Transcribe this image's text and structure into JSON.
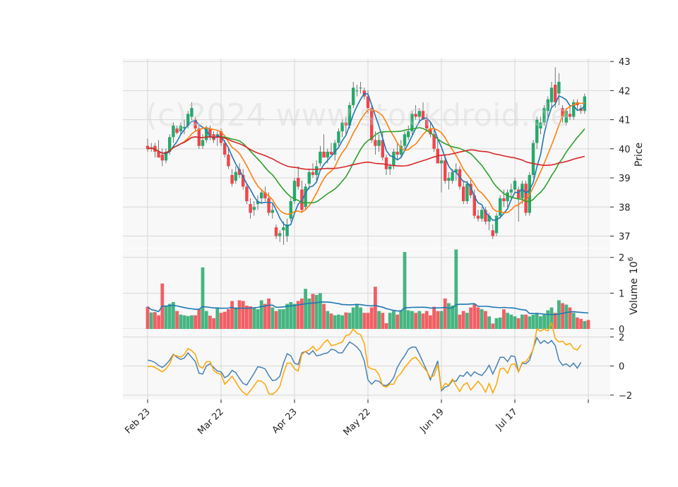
{
  "watermark": "(c)2024 www.stockdroid.de",
  "colors": {
    "up": "#26a96c",
    "down": "#f0454a",
    "sma5": "#1f77b4",
    "sma10": "#ff7f0e",
    "sma20": "#2ca02c",
    "sma50": "#d62728",
    "volma": "#1f77b4",
    "osc1": "#4682b4",
    "osc2": "#ffa500",
    "panel_bg": "#f8f8f8",
    "grid": "#d6d6d6"
  },
  "chart_data": [
    {
      "type": "candlestick",
      "ylabel": "Price",
      "ylim": [
        36.6,
        43.1
      ],
      "yticks": [
        "37",
        "38",
        "39",
        "40",
        "41",
        "42",
        "43"
      ],
      "x_ticks": [
        {
          "label": "Feb 23",
          "index": 0
        },
        {
          "label": "Mar 22",
          "index": 20
        },
        {
          "label": "Apr 23",
          "index": 40
        },
        {
          "label": "May 22",
          "index": 60
        },
        {
          "label": "Jun 19",
          "index": 80
        },
        {
          "label": "Jul 17",
          "index": 100
        },
        {
          "label": "",
          "index": 120
        }
      ],
      "grid": true,
      "ohlc": [
        [
          40.1,
          40.35,
          39.9,
          40.0
        ],
        [
          40.0,
          40.2,
          39.9,
          40.05
        ],
        [
          40.1,
          40.2,
          39.7,
          39.9
        ],
        [
          39.9,
          40.3,
          39.7,
          39.7
        ],
        [
          39.8,
          40.0,
          39.4,
          39.6
        ],
        [
          39.6,
          40.0,
          39.5,
          39.9
        ],
        [
          39.9,
          40.5,
          39.8,
          40.4
        ],
        [
          40.4,
          40.9,
          40.2,
          40.8
        ],
        [
          40.7,
          40.8,
          40.5,
          40.55
        ],
        [
          40.6,
          40.9,
          40.5,
          40.8
        ],
        [
          40.7,
          41.0,
          40.5,
          40.75
        ],
        [
          40.8,
          41.3,
          40.7,
          41.2
        ],
        [
          41.1,
          41.6,
          41.0,
          41.4
        ],
        [
          41.0,
          41.1,
          40.6,
          40.7
        ],
        [
          40.7,
          40.8,
          40.0,
          40.1
        ],
        [
          40.1,
          40.5,
          40.0,
          40.3
        ],
        [
          40.3,
          40.8,
          40.2,
          40.7
        ],
        [
          40.7,
          40.8,
          40.3,
          40.4
        ],
        [
          40.5,
          40.6,
          40.2,
          40.3
        ],
        [
          40.4,
          40.6,
          40.1,
          40.5
        ],
        [
          40.6,
          40.7,
          40.1,
          40.2
        ],
        [
          40.2,
          40.3,
          39.7,
          39.8
        ],
        [
          39.8,
          40.0,
          39.3,
          39.4
        ],
        [
          39.1,
          39.3,
          38.7,
          38.8
        ],
        [
          38.9,
          39.4,
          38.8,
          39.2
        ],
        [
          39.3,
          39.5,
          39.0,
          39.1
        ],
        [
          39.1,
          39.3,
          38.6,
          38.7
        ],
        [
          38.7,
          38.8,
          38.1,
          38.2
        ],
        [
          38.1,
          38.3,
          37.6,
          37.8
        ],
        [
          37.9,
          38.2,
          37.7,
          38.0
        ],
        [
          38.1,
          38.4,
          37.9,
          38.2
        ],
        [
          38.3,
          38.6,
          38.1,
          38.5
        ],
        [
          38.5,
          38.7,
          38.2,
          38.3
        ],
        [
          38.3,
          38.5,
          37.7,
          37.8
        ],
        [
          37.8,
          38.1,
          37.6,
          37.9
        ],
        [
          37.3,
          37.4,
          36.9,
          37.0
        ],
        [
          37.0,
          37.2,
          36.8,
          37.1
        ],
        [
          37.2,
          37.5,
          36.7,
          37.3
        ],
        [
          37.0,
          37.6,
          36.8,
          37.4
        ],
        [
          37.6,
          38.3,
          37.5,
          38.2
        ],
        [
          38.2,
          39.0,
          38.1,
          38.9
        ],
        [
          39.0,
          39.4,
          38.6,
          38.7
        ],
        [
          38.6,
          38.9,
          37.8,
          37.9
        ],
        [
          38.0,
          38.8,
          37.9,
          38.7
        ],
        [
          38.8,
          39.3,
          38.6,
          39.2
        ],
        [
          39.2,
          39.5,
          39.0,
          39.1
        ],
        [
          39.1,
          39.6,
          38.9,
          39.4
        ],
        [
          39.5,
          40.1,
          39.4,
          39.9
        ],
        [
          39.9,
          40.5,
          39.7,
          39.7
        ],
        [
          39.7,
          40.0,
          39.5,
          39.9
        ],
        [
          39.9,
          40.2,
          39.8,
          39.8
        ],
        [
          39.8,
          40.3,
          39.6,
          40.2
        ],
        [
          40.2,
          40.7,
          40.1,
          40.6
        ],
        [
          40.6,
          41.0,
          40.4,
          40.9
        ],
        [
          40.9,
          41.1,
          40.5,
          40.8
        ],
        [
          40.8,
          41.6,
          40.7,
          41.5
        ],
        [
          41.5,
          42.3,
          41.4,
          42.1
        ],
        [
          42.0,
          42.2,
          41.8,
          42.0
        ],
        [
          42.1,
          42.3,
          41.9,
          42.1
        ],
        [
          42.0,
          42.1,
          41.7,
          41.8
        ],
        [
          41.8,
          42.0,
          41.2,
          41.4
        ],
        [
          41.4,
          41.5,
          40.2,
          40.3
        ],
        [
          40.3,
          40.6,
          39.8,
          40.1
        ],
        [
          40.1,
          40.5,
          39.9,
          40.3
        ],
        [
          40.3,
          40.6,
          39.6,
          39.7
        ],
        [
          39.7,
          39.8,
          39.1,
          39.3
        ],
        [
          39.3,
          39.5,
          39.1,
          39.4
        ],
        [
          39.4,
          40.0,
          39.3,
          39.9
        ],
        [
          39.9,
          40.2,
          39.6,
          39.8
        ],
        [
          39.8,
          40.3,
          39.7,
          40.1
        ],
        [
          40.1,
          40.6,
          40.0,
          40.5
        ],
        [
          40.4,
          40.8,
          40.3,
          40.6
        ],
        [
          40.6,
          41.3,
          40.5,
          41.2
        ],
        [
          41.2,
          41.5,
          41.0,
          41.1
        ],
        [
          41.1,
          41.4,
          40.9,
          41.3
        ],
        [
          41.3,
          41.6,
          41.1,
          41.0
        ],
        [
          41.0,
          41.2,
          40.6,
          40.7
        ],
        [
          40.7,
          40.9,
          40.4,
          40.5
        ],
        [
          40.5,
          40.7,
          39.9,
          40.0
        ],
        [
          40.0,
          40.4,
          39.6,
          39.5
        ],
        [
          39.5,
          39.8,
          38.5,
          39.6
        ],
        [
          39.6,
          39.8,
          38.8,
          38.9
        ],
        [
          38.9,
          39.2,
          38.6,
          39.0
        ],
        [
          38.9,
          39.3,
          38.8,
          39.2
        ],
        [
          39.2,
          39.5,
          38.9,
          39.3
        ],
        [
          39.3,
          39.4,
          38.6,
          38.7
        ],
        [
          38.7,
          38.9,
          38.1,
          38.2
        ],
        [
          38.2,
          38.9,
          38.1,
          38.8
        ],
        [
          38.8,
          39.0,
          38.3,
          38.4
        ],
        [
          38.4,
          38.6,
          37.6,
          37.7
        ],
        [
          37.7,
          37.9,
          37.5,
          37.6
        ],
        [
          37.6,
          38.0,
          37.5,
          37.9
        ],
        [
          37.9,
          38.0,
          37.4,
          37.5
        ],
        [
          37.5,
          37.8,
          37.2,
          37.7
        ],
        [
          37.2,
          37.4,
          36.9,
          37.0
        ],
        [
          37.1,
          37.8,
          37.0,
          37.7
        ],
        [
          37.7,
          38.4,
          37.6,
          38.3
        ],
        [
          38.3,
          38.6,
          38.0,
          38.2
        ],
        [
          38.2,
          38.6,
          38.0,
          38.5
        ],
        [
          38.5,
          38.8,
          38.2,
          38.6
        ],
        [
          38.6,
          39.0,
          38.5,
          38.9
        ],
        [
          38.6,
          38.7,
          37.5,
          38.3
        ],
        [
          38.3,
          38.9,
          38.1,
          38.8
        ],
        [
          38.8,
          38.9,
          37.7,
          37.8
        ],
        [
          37.8,
          39.2,
          37.7,
          39.1
        ],
        [
          39.1,
          40.3,
          39.0,
          40.2
        ],
        [
          40.2,
          41.1,
          40.0,
          41.0
        ],
        [
          40.7,
          41.1,
          40.5,
          40.9
        ],
        [
          40.9,
          41.5,
          40.8,
          41.4
        ],
        [
          41.3,
          41.8,
          41.1,
          41.7
        ],
        [
          41.6,
          42.3,
          41.4,
          42.1
        ],
        [
          42.2,
          42.8,
          41.4,
          41.6
        ],
        [
          41.9,
          42.6,
          41.5,
          42.3
        ],
        [
          41.4,
          41.5,
          40.9,
          41.1
        ],
        [
          40.9,
          41.4,
          40.8,
          41.3
        ],
        [
          41.2,
          41.5,
          41.0,
          41.1
        ],
        [
          41.1,
          41.7,
          41.0,
          41.6
        ],
        [
          41.6,
          41.7,
          41.3,
          41.5
        ],
        [
          41.4,
          41.5,
          41.2,
          41.3
        ],
        [
          41.3,
          41.9,
          41.2,
          41.8
        ]
      ],
      "series": [
        {
          "type": "sma",
          "period": 5,
          "color": "#1f77b4"
        },
        {
          "type": "sma",
          "period": 10,
          "color": "#ff7f0e"
        },
        {
          "type": "sma",
          "period": 20,
          "color": "#2ca02c"
        },
        {
          "type": "sma",
          "period": 50,
          "color": "#d62728"
        }
      ]
    },
    {
      "type": "bar",
      "ylabel": "Volume",
      "ylabel_unit": "10",
      "ylabel_exp": "6",
      "ylim": [
        0,
        2.25
      ],
      "yticks": [
        "0",
        "1",
        "2"
      ],
      "values": [
        0.62,
        0.46,
        0.47,
        0.38,
        1.27,
        0.63,
        0.7,
        0.75,
        0.5,
        0.4,
        0.38,
        0.36,
        0.38,
        0.38,
        0.55,
        1.72,
        0.5,
        0.37,
        0.3,
        0.6,
        0.45,
        0.48,
        0.55,
        0.78,
        0.6,
        0.8,
        0.78,
        0.65,
        0.63,
        0.6,
        0.55,
        0.8,
        0.7,
        0.85,
        0.6,
        0.5,
        0.55,
        0.55,
        0.7,
        0.75,
        0.7,
        0.78,
        0.85,
        1.12,
        0.85,
        0.98,
        0.95,
        1.0,
        0.7,
        0.5,
        0.43,
        0.38,
        0.4,
        0.38,
        0.46,
        0.45,
        0.6,
        0.7,
        0.6,
        0.45,
        0.45,
        0.6,
        1.18,
        0.5,
        0.45,
        0.16,
        0.45,
        0.5,
        0.4,
        0.52,
        2.15,
        0.52,
        0.5,
        0.45,
        0.5,
        0.43,
        0.5,
        0.38,
        0.62,
        0.5,
        0.5,
        0.85,
        0.72,
        0.65,
        2.22,
        0.4,
        0.5,
        0.45,
        0.6,
        0.7,
        0.6,
        0.55,
        0.5,
        0.35,
        0.15,
        0.3,
        0.32,
        0.55,
        0.45,
        0.4,
        0.35,
        0.3,
        0.4,
        0.4,
        0.35,
        0.4,
        0.45,
        0.35,
        0.4,
        0.52,
        0.6,
        0.45,
        0.8,
        0.72,
        0.68,
        0.6,
        0.45,
        0.32,
        0.28,
        0.22,
        0.25
      ],
      "series": [
        {
          "type": "sma",
          "period": 20,
          "color": "#1f77b4"
        }
      ]
    },
    {
      "type": "line",
      "ylim": [
        -2.3,
        2.55
      ],
      "yticks": [
        "−2",
        "0",
        "2"
      ],
      "series": [
        {
          "color": "#4682b4",
          "values": [
            0.4,
            0.36,
            0.24,
            0.04,
            -0.1,
            0.1,
            0.4,
            0.8,
            0.6,
            0.45,
            0.55,
            0.9,
            0.6,
            0.3,
            -0.5,
            -0.55,
            0.0,
            0.15,
            -0.1,
            -0.35,
            -0.4,
            -0.8,
            -0.65,
            -0.3,
            -0.45,
            -0.85,
            -1.2,
            -1.3,
            -0.9,
            -0.5,
            -0.05,
            -0.1,
            -0.2,
            -0.65,
            -1.0,
            -0.95,
            -0.7,
            0.2,
            0.85,
            0.7,
            0.2,
            0.1,
            0.9,
            1.0,
            0.8,
            1.05,
            0.7,
            0.75,
            0.85,
            0.9,
            1.15,
            1.1,
            0.9,
            0.9,
            1.3,
            1.65,
            1.5,
            1.3,
            1.0,
            0.35,
            -0.95,
            -1.25,
            -1.0,
            -1.05,
            -1.3,
            -1.35,
            -1.15,
            -0.8,
            -0.1,
            0.35,
            0.7,
            1.15,
            1.3,
            1.3,
            0.8,
            0.25,
            -0.3,
            -0.95,
            -0.3,
            0.35,
            -1.7,
            -1.45,
            -1.35,
            -1.0,
            -1.05,
            -0.65,
            -0.7,
            -0.4,
            -0.7,
            -0.4,
            -0.55,
            -0.65,
            -0.35,
            0.05,
            -0.55,
            0.0,
            0.6,
            0.6,
            0.3,
            0.7,
            0.65,
            -0.4,
            0.2,
            0.15,
            0.4,
            1.2,
            1.95,
            1.55,
            1.75,
            1.55,
            1.75,
            1.4,
            0.4,
            0.05,
            0.15,
            -0.05,
            0.2,
            -0.15,
            0.25
          ]
        },
        {
          "color": "#ffa500",
          "values": [
            -0.05,
            0.0,
            -0.1,
            -0.25,
            -0.4,
            -0.2,
            0.15,
            0.75,
            0.7,
            0.6,
            0.8,
            1.2,
            1.05,
            0.8,
            0.0,
            -0.15,
            0.3,
            0.3,
            -0.3,
            -0.5,
            -0.55,
            -1.25,
            -1.0,
            -0.7,
            -1.1,
            -1.5,
            -1.8,
            -2.0,
            -1.7,
            -1.35,
            -1.0,
            -1.05,
            -1.25,
            -1.9,
            -1.95,
            -1.75,
            -1.4,
            -0.5,
            0.2,
            0.2,
            -0.2,
            -0.35,
            0.8,
            1.0,
            1.1,
            1.35,
            1.05,
            1.25,
            1.6,
            1.8,
            1.4,
            1.45,
            1.55,
            1.65,
            2.1,
            2.15,
            2.55,
            2.25,
            2.15,
            1.55,
            -0.05,
            -0.2,
            -0.25,
            -0.6,
            -1.35,
            -1.45,
            -1.25,
            -1.25,
            -0.75,
            -0.5,
            -0.1,
            0.2,
            0.5,
            0.6,
            0.3,
            -0.05,
            -0.35,
            -0.8,
            -0.65,
            0.1,
            -1.6,
            -1.2,
            -1.3,
            -0.9,
            -1.35,
            -1.75,
            -1.3,
            -1.15,
            -1.65,
            -1.35,
            -1.05,
            -1.35,
            -1.8,
            -1.2,
            -1.85,
            -1.25,
            -0.2,
            -0.15,
            -0.5,
            0.1,
            0.15,
            -0.4,
            0.25,
            0.3,
            0.65,
            1.15,
            2.55,
            2.4,
            2.55,
            2.4,
            2.95,
            1.9,
            1.65,
            1.7,
            1.45,
            1.55,
            1.2,
            1.1,
            1.45
          ]
        }
      ]
    }
  ]
}
